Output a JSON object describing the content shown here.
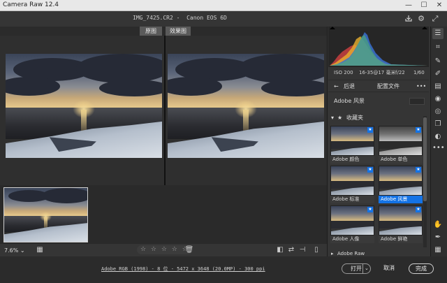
{
  "window": {
    "title": "Camera Raw 12.4",
    "minimize": "—",
    "maximize": "☐",
    "close": "✕"
  },
  "document": {
    "filename": "IMG_7425.CR2 -  Canon EOS 6D"
  },
  "view_tabs": {
    "before": "原图",
    "after": "效果图"
  },
  "toolbar_icons": [
    "save-icon",
    "gear-icon",
    "fullscreen-icon"
  ],
  "exif": {
    "iso": "ISO 200",
    "lens": "16-35@17 毫米",
    "aperture": "f/22",
    "shutter": "1/60"
  },
  "nav": {
    "back_label": "后退",
    "title": "配置文件",
    "more": "•••"
  },
  "profile": {
    "current": "Adobe 风景"
  },
  "favorites": {
    "group_label": "收藏夹"
  },
  "profiles": [
    {
      "label": "Adobe 颜色",
      "selected": false,
      "tone": "color"
    },
    {
      "label": "Adobe 单色",
      "selected": false,
      "tone": "mono"
    },
    {
      "label": "Adobe 标准",
      "selected": false,
      "tone": "color"
    },
    {
      "label": "Adobe 风景",
      "selected": true,
      "tone": "color"
    },
    {
      "label": "Adobe 人像",
      "selected": false,
      "tone": "color"
    },
    {
      "label": "Adobe 鲜艳",
      "selected": false,
      "tone": "color"
    }
  ],
  "next_group": {
    "label": "Adobe Raw"
  },
  "bottom": {
    "zoom": "7.6%",
    "stars": "☆ ☆ ☆ ☆ ☆",
    "info_link": "Adobe RGB (1998) - 8 位 - 5472 x 3648 (20.0MP) - 300 ppi"
  },
  "buttons": {
    "open": "打开",
    "cancel": "取消",
    "done": "完成"
  },
  "colors": {
    "accent": "#1473e6",
    "panel": "#353535",
    "background": "#2b2b2b"
  }
}
